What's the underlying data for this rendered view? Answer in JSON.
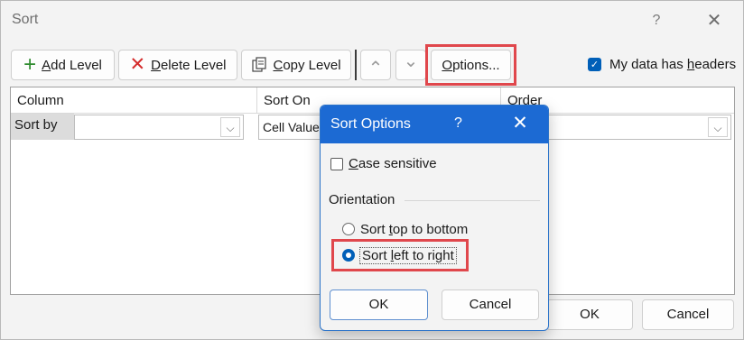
{
  "dialog": {
    "title": "Sort",
    "help": "?",
    "close": "✕"
  },
  "toolbar": {
    "add_level": {
      "mnemonic": "A",
      "rest": "dd Level"
    },
    "delete_level": {
      "mnemonic": "D",
      "rest": "elete Level"
    },
    "copy_level": {
      "mnemonic": "C",
      "rest": "opy Level"
    },
    "move_up": "⌃",
    "move_down": "⌄",
    "options": {
      "mnemonic": "O",
      "rest": "ptions..."
    },
    "headers_checkbox": {
      "before": "My data has ",
      "mnemonic": "h",
      "after": "eaders",
      "checked": true
    }
  },
  "grid": {
    "columns": [
      "Column",
      "Sort On",
      "Order"
    ],
    "row": {
      "label": "Sort by",
      "column_value": "",
      "sort_on_value": "Cell Values",
      "order_value": ""
    }
  },
  "bottom_buttons": {
    "ok": "OK",
    "cancel": "Cancel"
  },
  "sort_options": {
    "title": "Sort Options",
    "help": "?",
    "close": "✕",
    "case_sensitive": {
      "mnemonic": "C",
      "rest": "ase sensitive",
      "checked": false
    },
    "orientation_label": "Orientation",
    "top_to_bottom": {
      "before": "Sort ",
      "mnemonic": "t",
      "after": "op to bottom",
      "selected": false
    },
    "left_to_right": {
      "before": "Sort ",
      "mnemonic": "l",
      "after": "eft to right",
      "selected": true
    },
    "ok": "OK",
    "cancel": "Cancel"
  },
  "colors": {
    "accent": "#005fb8",
    "title_bar": "#1c6ad3",
    "highlight": "#e0474c"
  }
}
